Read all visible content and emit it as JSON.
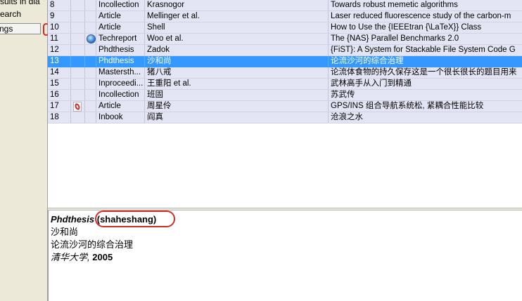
{
  "sidebar": {
    "items": [
      {
        "label": "sults in dia"
      },
      {
        "label": "earch"
      },
      {
        "label": "ngs"
      }
    ]
  },
  "table": {
    "rows": [
      {
        "num": "8",
        "pdf": false,
        "web": false,
        "type": "Incollection",
        "author": "Krasnogor",
        "title": "Towards robust memetic algorithms"
      },
      {
        "num": "9",
        "pdf": false,
        "web": false,
        "type": "Article",
        "author": "Mellinger et al.",
        "title": "Laser reduced fluorescence study of the carbon-m"
      },
      {
        "num": "10",
        "pdf": false,
        "web": false,
        "type": "Article",
        "author": "Shell",
        "title": "How to Use the {IEEEtran {\\LaTeX}} Class"
      },
      {
        "num": "11",
        "pdf": false,
        "web": true,
        "type": "Techreport",
        "author": "Woo et al.",
        "title": "The {NAS} Parallel Benchmarks 2.0"
      },
      {
        "num": "12",
        "pdf": false,
        "web": false,
        "type": "Phdthesis",
        "author": "Zadok",
        "title": "{FiST}: A System for Stackable File System Code G"
      },
      {
        "num": "13",
        "pdf": false,
        "web": false,
        "type": "Phdthesis",
        "author": "沙和尚",
        "title": "论流沙河的综合治理",
        "selected": true
      },
      {
        "num": "14",
        "pdf": false,
        "web": false,
        "type": "Mastersth...",
        "author": "猪八戒",
        "title": "论流体食物的持久保存这是一个很长很长的题目用来"
      },
      {
        "num": "15",
        "pdf": false,
        "web": false,
        "type": "Inproceedi...",
        "author": "王重阳 et al.",
        "title": "武林高手从入门到精通"
      },
      {
        "num": "16",
        "pdf": false,
        "web": false,
        "type": "Incollection",
        "author": "班固",
        "title": "苏武传"
      },
      {
        "num": "17",
        "pdf": true,
        "web": false,
        "type": "Article",
        "author": "周星伶",
        "title": "GPS/INS 组合导航系统松, 紧耦合性能比较"
      },
      {
        "num": "18",
        "pdf": false,
        "web": false,
        "type": "Inbook",
        "author": "阎真",
        "title": "沧浪之水"
      }
    ]
  },
  "preview": {
    "type": "Phdthesis",
    "key": "(shaheshang)",
    "author": "沙和尚",
    "title": "论流沙河的综合治理",
    "institution": "清华大学,",
    "year": "2005"
  },
  "colors": {
    "row_bg": "#e3e5f5",
    "selected_bg": "#3399ff",
    "annotation_red": "#d12a2a"
  },
  "icons": {
    "web": "globe-icon",
    "pdf": "pdf-icon"
  }
}
